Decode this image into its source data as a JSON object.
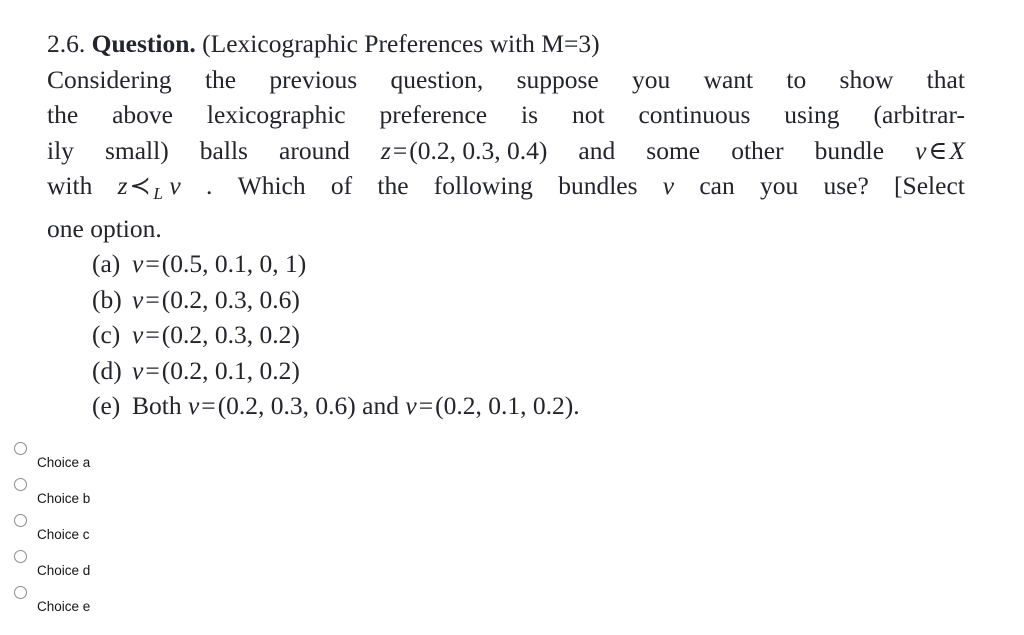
{
  "question": {
    "number": "2.6.",
    "label": "Question.",
    "title_paren": "(Lexicographic Preferences with M=3)",
    "body_lines": [
      {
        "words": [
          "Considering",
          "the",
          "previous",
          "question,",
          "suppose",
          "you",
          "want",
          "to",
          "show",
          "that"
        ]
      },
      {
        "words": [
          "the",
          "above",
          "lexicographic",
          "preference",
          "is",
          "not",
          "continuous",
          "using",
          "(arbitrar-"
        ]
      },
      {
        "words": [
          "ily",
          "small)",
          "balls",
          "around",
          "z_eq",
          "and",
          "some",
          "other",
          "bundle",
          "v_in_X"
        ]
      },
      {
        "words": [
          "with",
          "z_prec_v",
          ".",
          "Which",
          "of",
          "the",
          "following",
          "bundles",
          "v",
          "can",
          "you",
          "use?",
          "[Select"
        ]
      }
    ],
    "last_line": "one option.",
    "z_variable": "z",
    "z_value": "(0.2, 0.3, 0.4)",
    "v_variable": "v",
    "set_symbol": "∈",
    "set_name": "X",
    "prec_symbol": "≺",
    "prec_subscript": "L",
    "equals": "="
  },
  "options": [
    {
      "tag": "(a)",
      "prefix": "v",
      "relation": "=",
      "value": "(0.5, 0.1, 0, 1)",
      "suffix": ""
    },
    {
      "tag": "(b)",
      "prefix": "v",
      "relation": "=",
      "value": "(0.2, 0.3, 0.6)",
      "suffix": ""
    },
    {
      "tag": "(c)",
      "prefix": "v",
      "relation": "=",
      "value": "(0.2, 0.3, 0.2)",
      "suffix": ""
    },
    {
      "tag": "(d)",
      "prefix": "v",
      "relation": "=",
      "value": "(0.2, 0.1, 0.2)",
      "suffix": ""
    },
    {
      "tag": "(e)",
      "both_word": "Both",
      "prefix": "v",
      "relation": "=",
      "value": "(0.2, 0.3, 0.6)",
      "conjunction": "and",
      "prefix2": "v",
      "relation2": "=",
      "value2": "(0.2, 0.1, 0.2)",
      "suffix": "."
    }
  ],
  "choices": [
    {
      "label": "Choice a",
      "selected": false
    },
    {
      "label": "Choice b",
      "selected": false
    },
    {
      "label": "Choice c",
      "selected": false
    },
    {
      "label": "Choice d",
      "selected": false
    },
    {
      "label": "Choice e",
      "selected": false
    }
  ],
  "colors": {
    "background": "#ffffff",
    "text": "#23242c",
    "choice_text": "#151515",
    "radio_border": "#8c8c8c"
  }
}
